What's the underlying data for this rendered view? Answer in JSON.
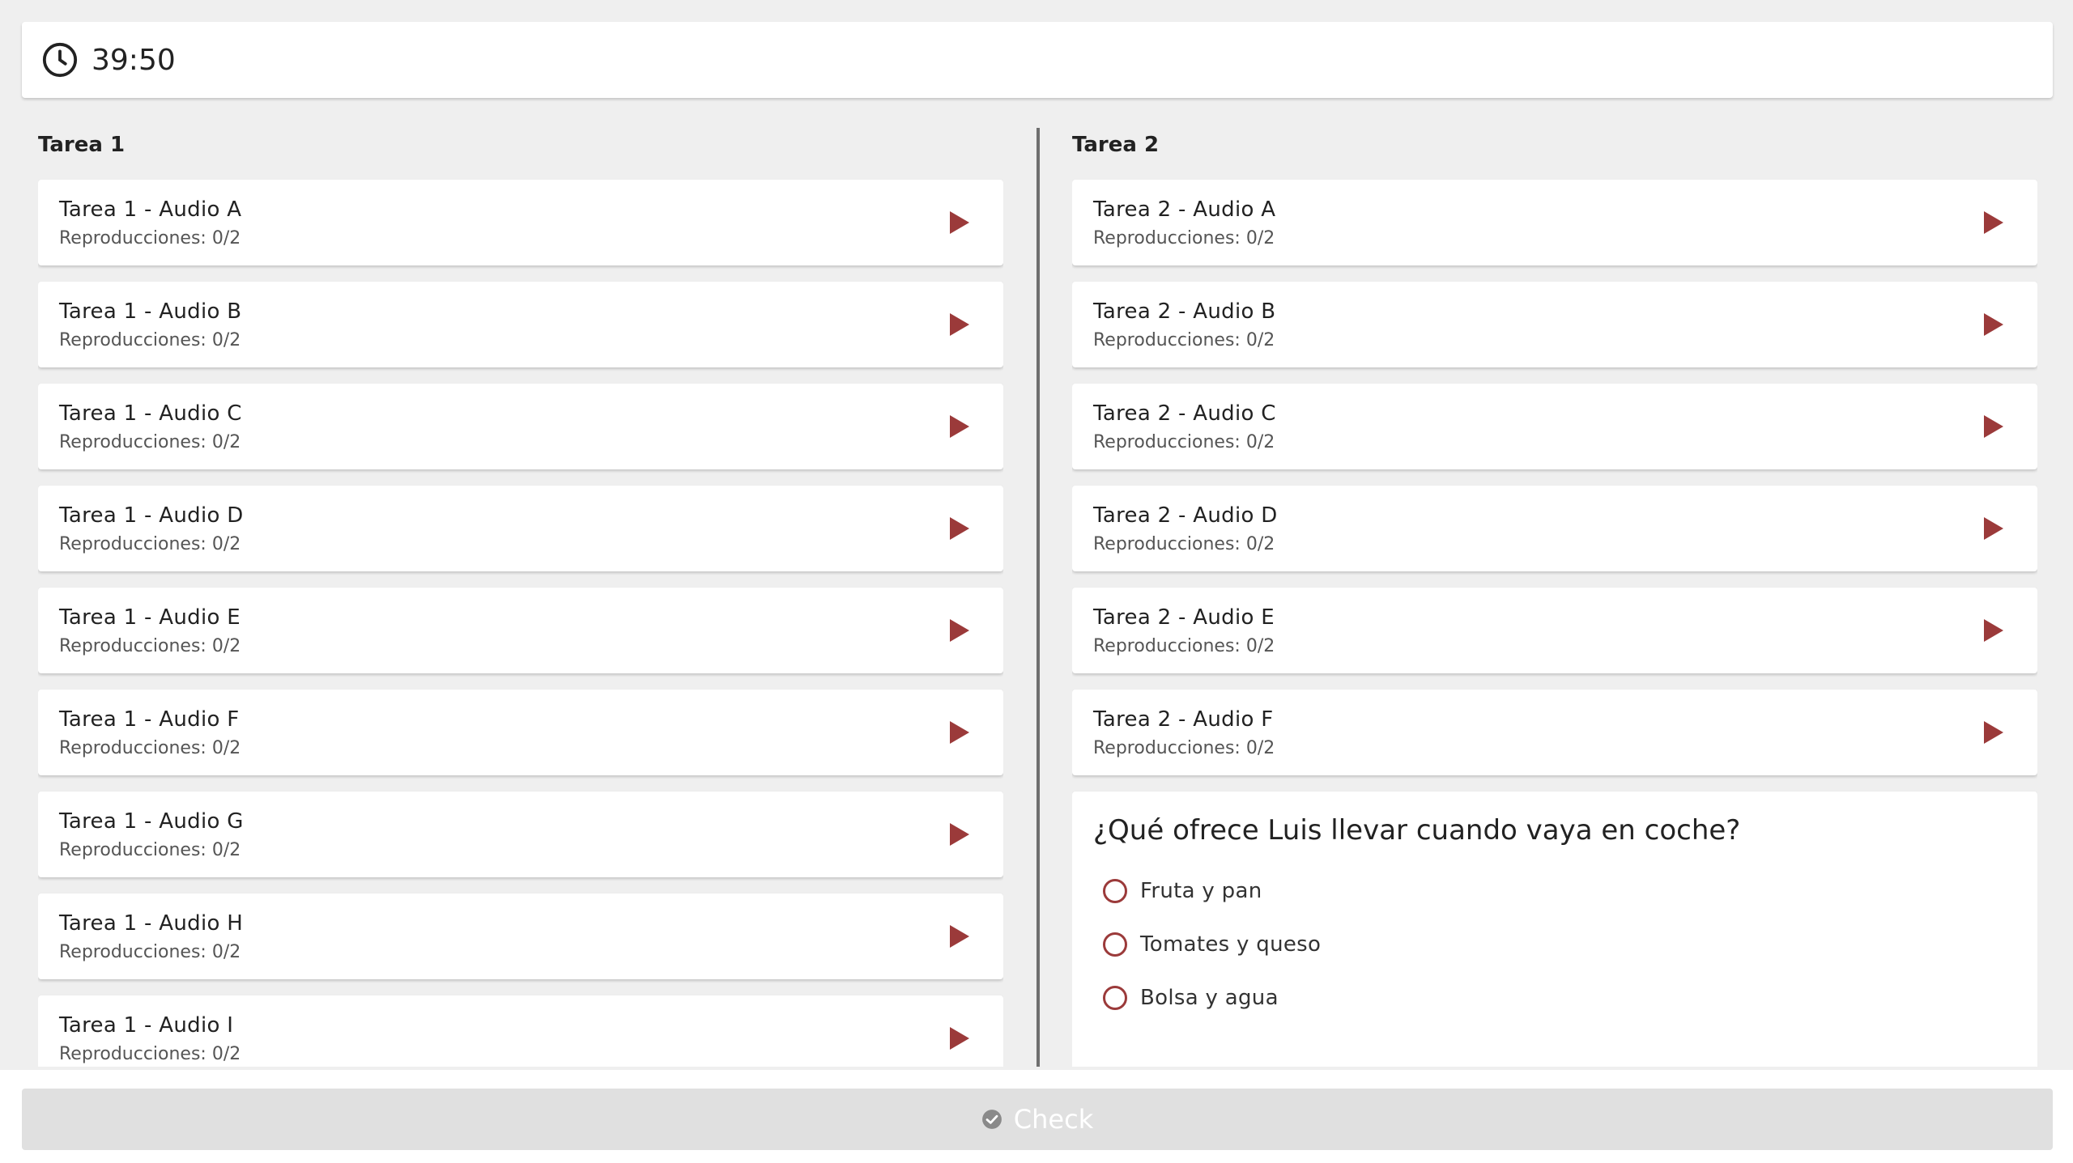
{
  "timer": {
    "value": "39:50",
    "icon": "clock-icon"
  },
  "colors": {
    "accent": "#9b3a3a",
    "divider": "#6f6f6f",
    "disabled": "#e0e0e0"
  },
  "left": {
    "title": "Tarea 1",
    "audios": [
      {
        "title": "Tarea 1 - Audio A",
        "plays": "Reproducciones: 0/2"
      },
      {
        "title": "Tarea 1 - Audio B",
        "plays": "Reproducciones: 0/2"
      },
      {
        "title": "Tarea 1 - Audio C",
        "plays": "Reproducciones: 0/2"
      },
      {
        "title": "Tarea 1 - Audio D",
        "plays": "Reproducciones: 0/2"
      },
      {
        "title": "Tarea 1 - Audio E",
        "plays": "Reproducciones: 0/2"
      },
      {
        "title": "Tarea 1 - Audio F",
        "plays": "Reproducciones: 0/2"
      },
      {
        "title": "Tarea 1 - Audio G",
        "plays": "Reproducciones: 0/2"
      },
      {
        "title": "Tarea 1 - Audio H",
        "plays": "Reproducciones: 0/2"
      },
      {
        "title": "Tarea 1 - Audio I",
        "plays": "Reproducciones: 0/2"
      }
    ]
  },
  "right": {
    "title": "Tarea 2",
    "audios": [
      {
        "title": "Tarea 2 - Audio A",
        "plays": "Reproducciones: 0/2"
      },
      {
        "title": "Tarea 2 - Audio B",
        "plays": "Reproducciones: 0/2"
      },
      {
        "title": "Tarea 2 - Audio C",
        "plays": "Reproducciones: 0/2"
      },
      {
        "title": "Tarea 2 - Audio D",
        "plays": "Reproducciones: 0/2"
      },
      {
        "title": "Tarea 2 - Audio E",
        "plays": "Reproducciones: 0/2"
      },
      {
        "title": "Tarea 2 - Audio F",
        "plays": "Reproducciones: 0/2"
      }
    ],
    "question": {
      "text": "¿Qué ofrece Luis llevar cuando vaya en coche?",
      "options": [
        "Fruta y pan",
        "Tomates y queso",
        "Bolsa y agua"
      ]
    }
  },
  "check": {
    "label": "Check",
    "icon": "check-circle-icon"
  }
}
